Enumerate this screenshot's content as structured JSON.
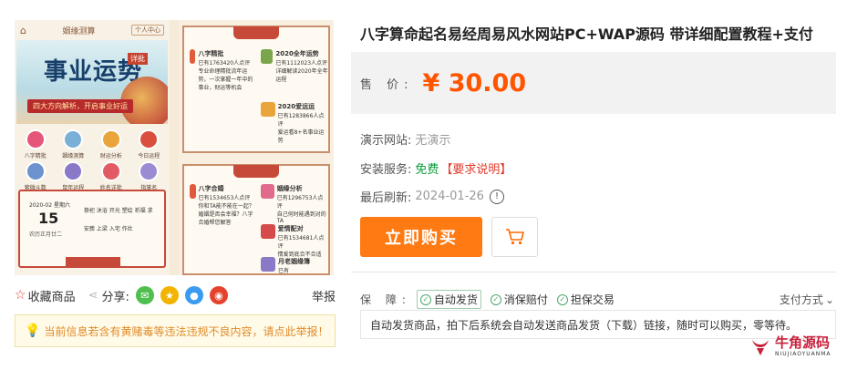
{
  "gallery": {
    "left_phone": {
      "top_title": "姻缘测算",
      "user_center": "个人中心",
      "banner_title": "事业运势",
      "banner_stamp": "详批",
      "banner_slogan": "四大方向解析，开启事业好运",
      "icons": [
        {
          "label": "八字精批",
          "color": "#e6557a"
        },
        {
          "label": "姻缘测算",
          "color": "#7ab0d6"
        },
        {
          "label": "财运分析",
          "color": "#e9a43b"
        },
        {
          "label": "今日运程",
          "color": "#d94e3c"
        },
        {
          "label": "紫微斗数",
          "color": "#6c93cf"
        },
        {
          "label": "鼠年运程",
          "color": "#8a78c8"
        },
        {
          "label": "姓名详批",
          "color": "#e25a64"
        },
        {
          "label": "指掌名",
          "color": "#9a8bd3"
        }
      ],
      "calendar": {
        "date": "2020-02 星期六",
        "day": "15",
        "lunar": "农历正月廿二",
        "yi": "祭祀 沐浴 开光 塑绘 祈福 求",
        "ji": "安葬 上梁 入宅 作灶"
      }
    },
    "right_phone": {
      "items_top": [
        {
          "title": "八字精批",
          "sub": "已有1763420人点评",
          "desc": "专业命理精批流年运势，一次掌握一年中的事业，财运等机会",
          "color": "#e25a3c"
        },
        {
          "title": "2020全年运势",
          "sub": "已有1112023人点评",
          "desc": "详细解读2020年全年运程",
          "color": "#7aa64b"
        },
        {
          "title": "2020爱运运",
          "sub": "已有1283866人点评",
          "desc": "爱运看8+名事业运势",
          "color": "#e9a43b"
        }
      ],
      "items_bottom": [
        {
          "title": "八字合婚",
          "sub": "已有1534653人点评",
          "desc": "你和TA能不能在一起？婚姻是否会幸福？八字合婚帮您解答",
          "color": "#e25a3c"
        },
        {
          "title": "姻缘分析",
          "sub": "已有1296753人点评",
          "desc": "自己何时能遇到对的TA",
          "color": "#e26a8c"
        },
        {
          "title": "爱情配对",
          "sub": "已有1534681人点评",
          "desc": "情爱到底合不合适",
          "color": "#d54a4a"
        },
        {
          "title": "月老姻缘簿",
          "sub": "已有",
          "desc": "",
          "color": "#8a78c8"
        }
      ]
    }
  },
  "share_row": {
    "favorite": "收藏商品",
    "share_label": "分享:",
    "report": "举报",
    "share_buttons": [
      {
        "name": "wechat",
        "color": "#4fc04f",
        "glyph": "✉"
      },
      {
        "name": "qzone",
        "color": "#f2b400",
        "glyph": "★"
      },
      {
        "name": "qq",
        "color": "#3b9bf1",
        "glyph": "●"
      },
      {
        "name": "weibo",
        "color": "#e6412c",
        "glyph": "◉"
      }
    ]
  },
  "notice": {
    "text": "当前信息若含有黄赌毒等违法违规不良内容，请点此举报！"
  },
  "product": {
    "title": "八字算命起名易经周易风水网站PC+WAP源码 带详细配置教程+支付",
    "price_label": "售  价:",
    "price": "¥ 30.00",
    "demo_label": "演示网站:",
    "demo_value": "无演示",
    "service_label": "安装服务:",
    "service_value": "免费",
    "service_req": "【要求说明】",
    "refresh_label": "最后刷新:",
    "refresh_value": "2024-01-26",
    "buy_label": "立即购买"
  },
  "guarantee": {
    "label": "保  障:",
    "items": [
      {
        "label": "自动发货",
        "active": true
      },
      {
        "label": "消保赔付",
        "active": false
      },
      {
        "label": "担保交易",
        "active": false
      }
    ],
    "pay_label": "支付方式",
    "description": "自动发货商品，拍下后系统会自动发送商品发货（下载）链接，随时可以购买，零等待。"
  },
  "logo": {
    "cn": "牛角源码",
    "en": "NIUJIAOYUANMA"
  }
}
